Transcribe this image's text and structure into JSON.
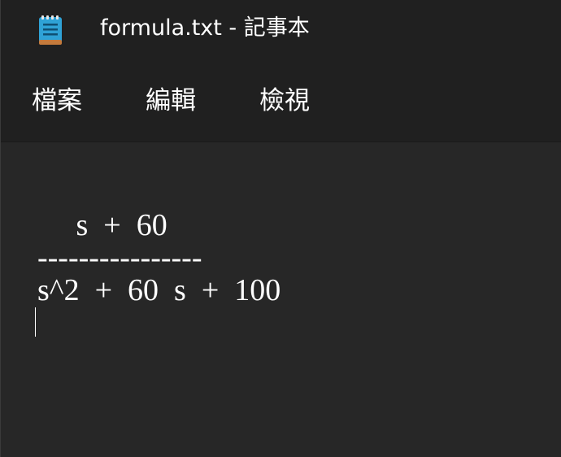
{
  "window": {
    "title": "formula.txt - 記事本",
    "app_icon": "notepad-icon"
  },
  "menu": {
    "items": [
      {
        "label": "檔案"
      },
      {
        "label": "編輯"
      },
      {
        "label": "檢視"
      }
    ]
  },
  "document": {
    "lines": [
      "     s  +  60",
      "----------------",
      "s^2  +  60  s  +  100"
    ]
  }
}
